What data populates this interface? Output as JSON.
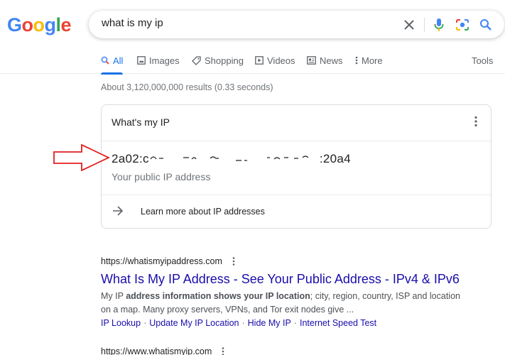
{
  "logo": {
    "letters": [
      "G",
      "o",
      "o",
      "g",
      "l",
      "e"
    ],
    "colors": [
      "#4285F4",
      "#EA4335",
      "#FBBC05",
      "#4285F4",
      "#34A853",
      "#EA4335"
    ]
  },
  "search": {
    "query": "what is my ip"
  },
  "icons": {
    "clear": "close-icon",
    "voice": "mic-icon",
    "lens": "camera-icon",
    "search": "search-icon"
  },
  "tabs": [
    {
      "label": "All",
      "icon": "search-icon",
      "active": true
    },
    {
      "label": "Images",
      "icon": "image-icon"
    },
    {
      "label": "Shopping",
      "icon": "tag-icon"
    },
    {
      "label": "Videos",
      "icon": "play-icon"
    },
    {
      "label": "News",
      "icon": "news-icon"
    },
    {
      "label": "More",
      "icon": "dots-vertical-icon"
    }
  ],
  "tools_label": "Tools",
  "stats": "About 3,120,000,000 results (0.33 seconds)",
  "ip_card": {
    "title": "What's my IP",
    "ip_visible_start": "2a02:c",
    "ip_visible_end": ":20a4",
    "description": "Your public IP address",
    "learn_more": "Learn more about IP addresses"
  },
  "results": [
    {
      "url": "https://whatismyipaddress.com",
      "title": "What Is My IP Address - See Your Public Address - IPv4 & IPv6",
      "snippet_parts": [
        {
          "text": "My IP ",
          "bold": false
        },
        {
          "text": "address information shows your IP location",
          "bold": true
        },
        {
          "text": "; city, region, country, ISP and location on a map. Many proxy servers, VPNs, and Tor exit nodes give ...",
          "bold": false
        }
      ],
      "sitelinks": [
        "IP Lookup",
        "Update My IP Location",
        "Hide My IP",
        "Internet Speed Test"
      ]
    },
    {
      "url": "https://www.whatismyip.com"
    }
  ],
  "colors": {
    "accent": "#1a73e8",
    "link": "#1a0dab",
    "annotation_arrow": "#e02020"
  }
}
